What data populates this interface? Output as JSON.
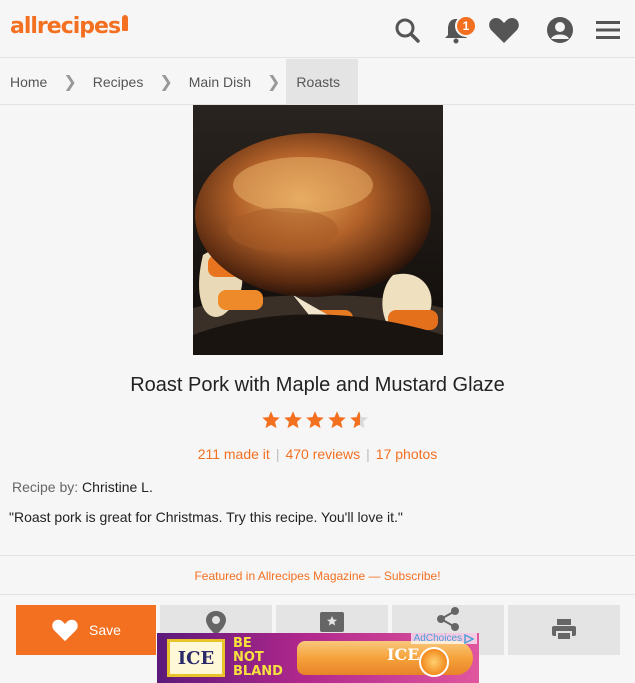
{
  "header": {
    "logo_text": "allrecipes",
    "notification_count": "1",
    "icons": [
      "search-icon",
      "bell-icon",
      "heart-icon",
      "user-icon",
      "menu-icon"
    ]
  },
  "breadcrumb": {
    "items": [
      "Home",
      "Recipes",
      "Main Dish",
      "Roasts"
    ]
  },
  "recipe": {
    "title": "Roast Pork with Maple and Mustard Glaze",
    "rating": 4.5,
    "made_it": "211 made it",
    "reviews": "470 reviews",
    "photos": "17 photos",
    "recipe_by_label": "Recipe by:",
    "author": "Christine L.",
    "description": "\"Roast pork is great for Christmas. Try this recipe. You'll love it.\""
  },
  "featured": {
    "text": "Featured in Allrecipes Magazine — Subscribe!"
  },
  "actions": {
    "save_label": "Save",
    "icons": [
      "heart-icon",
      "pin-icon",
      "rate-icon",
      "share-icon",
      "print-icon"
    ]
  },
  "ad": {
    "brand": "ICE",
    "slogan_line1": "BE",
    "slogan_line2": "NOT",
    "slogan_line3": "BLAND",
    "adchoices": "AdChoices"
  },
  "colors": {
    "accent": "#f37021",
    "background": "#f6f6f6",
    "button_gray": "#e4e4e4"
  }
}
